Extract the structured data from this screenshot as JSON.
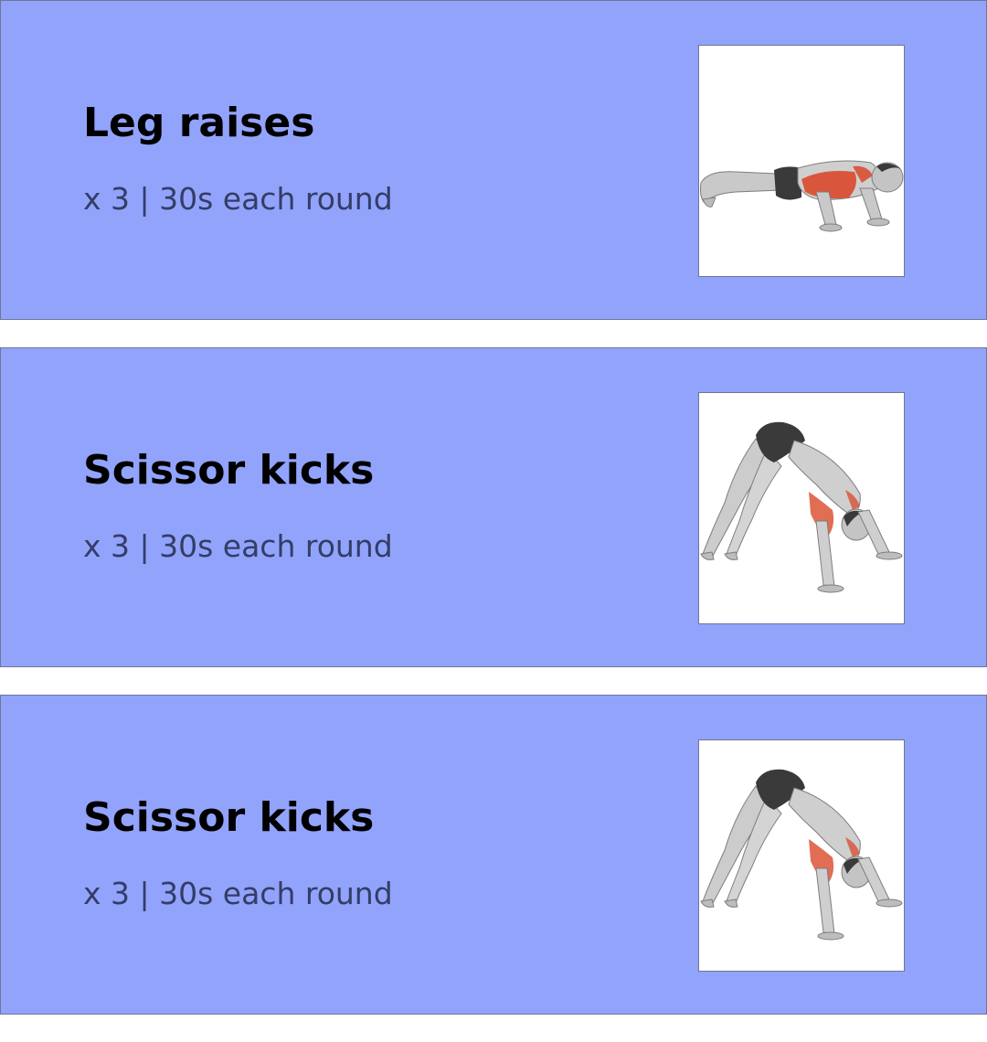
{
  "exercises": [
    {
      "title": "Leg raises",
      "detail": "x 3 | 30s each round",
      "illustration": "pushup-figure-icon"
    },
    {
      "title": "Scissor kicks",
      "detail": "x 3 | 30s each round",
      "illustration": "pike-pushup-figure-icon"
    },
    {
      "title": "Scissor kicks",
      "detail": "x 3 | 30s each round",
      "illustration": "pike-pushup-figure-icon"
    }
  ],
  "colors": {
    "card_background": "#92a3fc",
    "card_border": "#6f7696",
    "title_text": "#000000",
    "detail_text": "#333d66",
    "muscle_highlight": "#d9482b"
  }
}
